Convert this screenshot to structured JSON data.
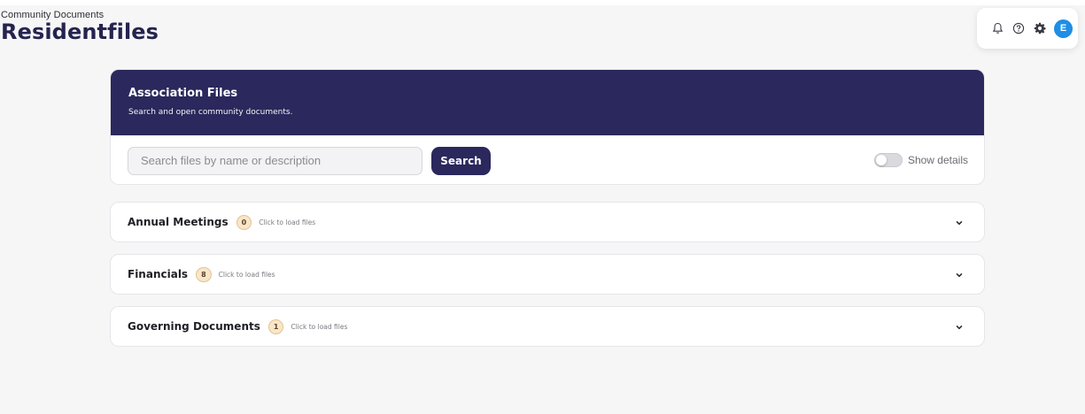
{
  "breadcrumb": "Community Documents",
  "page_title": "Residentfiles",
  "toolbar": {
    "icons": [
      "bell-icon",
      "help-icon",
      "gear-icon"
    ],
    "avatar_initial": "E",
    "avatar_color": "#1e8ee6"
  },
  "files_panel": {
    "title": "Association Files",
    "subtitle": "Search and open community documents.",
    "search_placeholder": "Search files by name or description",
    "search_value": "",
    "search_button": "Search",
    "toggle_label": "Show details",
    "toggle_on": false
  },
  "sections": [
    {
      "name": "Annual Meetings",
      "count": "0",
      "hint": "Click to load files"
    },
    {
      "name": "Financials",
      "count": "8",
      "hint": "Click to load files"
    },
    {
      "name": "Governing Documents",
      "count": "1",
      "hint": "Click to load files"
    }
  ],
  "colors": {
    "header_bg": "#2a285c",
    "accent_button": "#2a285c",
    "badge_bg": "#f9e6c9",
    "page_bg": "#f6f6f7"
  }
}
